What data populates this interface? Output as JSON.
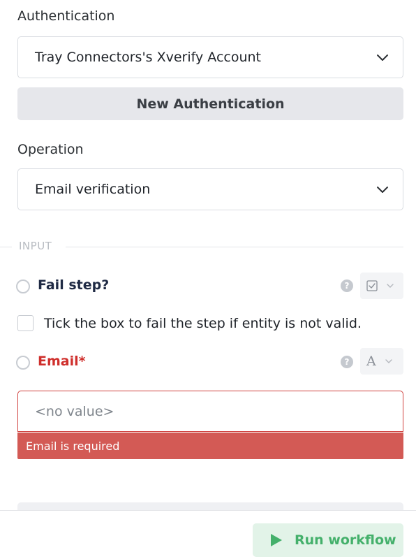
{
  "authentication": {
    "label": "Authentication",
    "selected": "Tray Connectors's Xverify Account",
    "new_button": "New Authentication"
  },
  "operation": {
    "label": "Operation",
    "selected": "Email verification"
  },
  "input_section": {
    "title": "INPUT"
  },
  "fail_step": {
    "label": "Fail step?",
    "help_glyph": "?",
    "type_icon": "checkbox-type-icon",
    "checkbox_text": "Tick the box to fail the step if entity is not valid."
  },
  "email": {
    "label": "Email*",
    "help_glyph": "?",
    "type_glyph": "A",
    "placeholder": "<no value>",
    "error": "Email is required"
  },
  "footer": {
    "run_label": "Run workflow"
  },
  "colors": {
    "error_red": "#d0413e",
    "error_bar": "#d35a55",
    "run_green": "#44b06b",
    "run_bg": "#e2f3e8"
  }
}
